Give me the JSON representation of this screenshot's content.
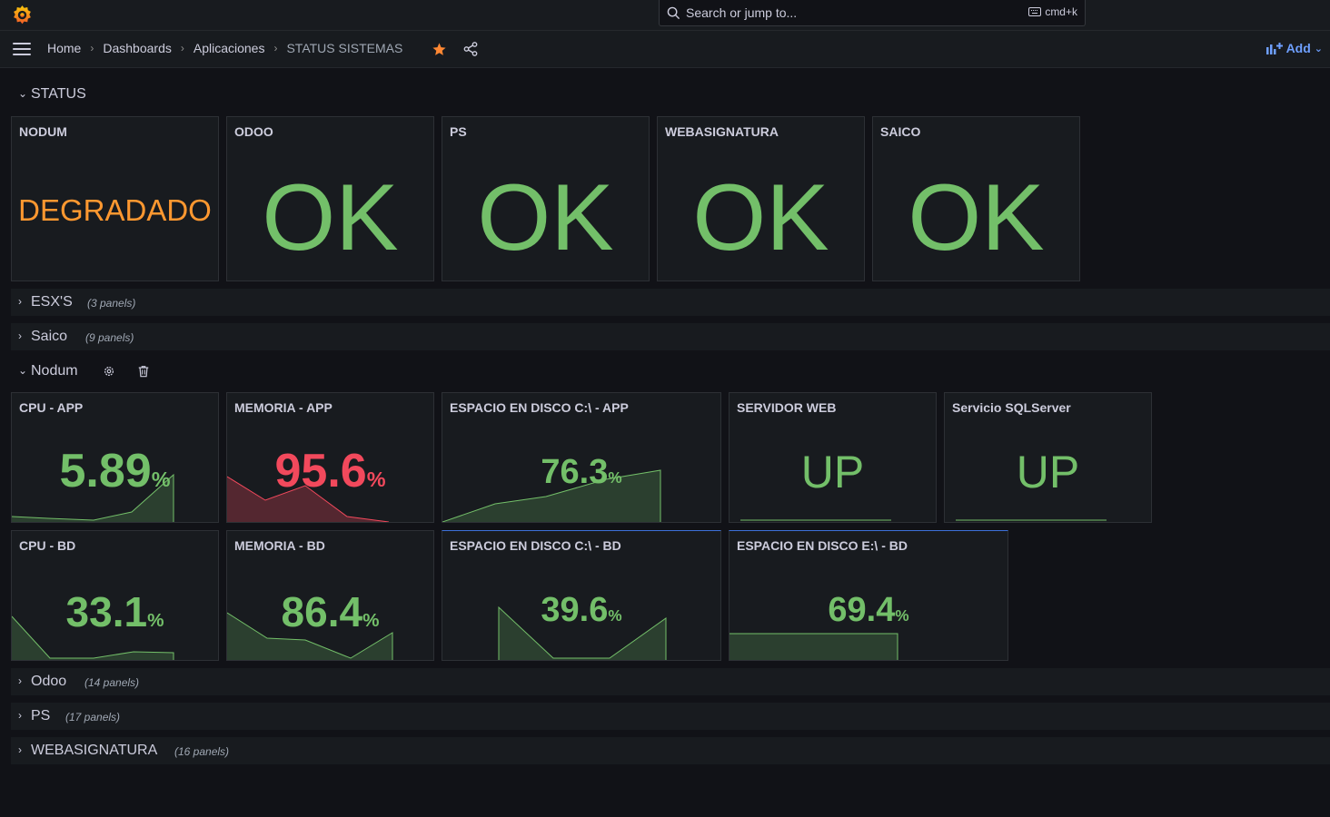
{
  "topbar": {
    "search_placeholder": "Search or jump to...",
    "shortcut": "cmd+k"
  },
  "breadcrumb": [
    "Home",
    "Dashboards",
    "Aplicaciones",
    "STATUS SISTEMAS"
  ],
  "add_label": "Add",
  "rows": {
    "status": {
      "title": "STATUS"
    },
    "esx": {
      "title": "ESX'S",
      "count": "(3 panels)"
    },
    "saico": {
      "title": "Saico",
      "count": "(9 panels)"
    },
    "nodum": {
      "title": "Nodum"
    },
    "odoo": {
      "title": "Odoo",
      "count": "(14 panels)"
    },
    "ps": {
      "title": "PS",
      "count": "(17 panels)"
    },
    "webasig": {
      "title": "WEBASIGNATURA",
      "count": "(16 panels)"
    }
  },
  "status_panels": [
    {
      "title": "NODUM",
      "value": "DEGRADADO"
    },
    {
      "title": "ODOO",
      "value": "OK"
    },
    {
      "title": "PS",
      "value": "OK"
    },
    {
      "title": "WEBASIGNATURA",
      "value": "OK"
    },
    {
      "title": "SAICO",
      "value": "OK"
    }
  ],
  "nodum_panels": [
    {
      "title": "CPU - APP",
      "value": "5.89",
      "unit": "%"
    },
    {
      "title": "MEMORIA - APP",
      "value": "95.6",
      "unit": "%"
    },
    {
      "title": "ESPACIO EN DISCO C:\\ - APP",
      "value": "76.3",
      "unit": "%"
    },
    {
      "title": "SERVIDOR WEB",
      "value": "UP"
    },
    {
      "title": "Servicio SQLServer",
      "value": "UP"
    },
    {
      "title": "CPU - BD",
      "value": "33.1",
      "unit": "%"
    },
    {
      "title": "MEMORIA - BD",
      "value": "86.4",
      "unit": "%"
    },
    {
      "title": "ESPACIO EN DISCO C:\\ - BD",
      "value": "39.6",
      "unit": "%"
    },
    {
      "title": "ESPACIO EN DISCO E:\\ - BD",
      "value": "69.4",
      "unit": "%"
    }
  ],
  "colors": {
    "ok": "#73bf69",
    "warning": "#ff9830",
    "critical": "#f2495c",
    "accent": "#6e9fff"
  }
}
